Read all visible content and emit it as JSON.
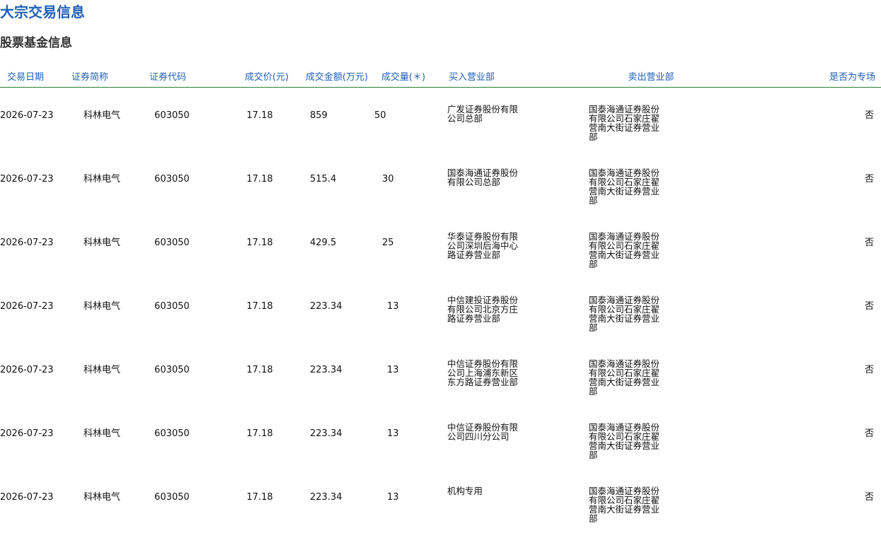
{
  "page": {
    "title": "大宗交易信息",
    "section_title": "股票基金信息"
  },
  "colors": {
    "title": "#1f5fb8",
    "header_text": "#1f5fb8",
    "header_rule": "#2e7d32",
    "body_text": "#111111"
  },
  "table": {
    "headers": {
      "date": "交易日期",
      "name": "证券简称",
      "code": "证券代码",
      "price": "成交价(元)",
      "amount": "成交金额(万元)",
      "volume": "成交量(＊)",
      "buyer": "买入营业部",
      "seller": "卖出营业部",
      "special": "是否为专场"
    },
    "rows": [
      {
        "date": "2026-07-23",
        "name": "科林电气",
        "code": "603050",
        "price": "17.18",
        "amount": "859",
        "volume": "50",
        "buyer": "广发证券股份有限公司总部",
        "seller": "国泰海通证券股份有限公司石家庄翟营南大街证券营业部",
        "special": "否"
      },
      {
        "date": "2026-07-23",
        "name": "科林电气",
        "code": "603050",
        "price": "17.18",
        "amount": "515.4",
        "volume": "30",
        "buyer": "国泰海通证券股份有限公司总部",
        "seller": "国泰海通证券股份有限公司石家庄翟营南大街证券营业部",
        "special": "否"
      },
      {
        "date": "2026-07-23",
        "name": "科林电气",
        "code": "603050",
        "price": "17.18",
        "amount": "429.5",
        "volume": "25",
        "buyer": "华泰证券股份有限公司深圳后海中心路证券营业部",
        "seller": "国泰海通证券股份有限公司石家庄翟营南大街证券营业部",
        "special": "否"
      },
      {
        "date": "2026-07-23",
        "name": "科林电气",
        "code": "603050",
        "price": "17.18",
        "amount": "223.34",
        "volume": "13",
        "buyer": "中信建投证券股份有限公司北京方庄路证券营业部",
        "seller": "国泰海通证券股份有限公司石家庄翟营南大街证券营业部",
        "special": "否"
      },
      {
        "date": "2026-07-23",
        "name": "科林电气",
        "code": "603050",
        "price": "17.18",
        "amount": "223.34",
        "volume": "13",
        "buyer": "中信证券股份有限公司上海浦东新区东方路证券营业部",
        "seller": "国泰海通证券股份有限公司石家庄翟营南大街证券营业部",
        "special": "否"
      },
      {
        "date": "2026-07-23",
        "name": "科林电气",
        "code": "603050",
        "price": "17.18",
        "amount": "223.34",
        "volume": "13",
        "buyer": "中信证券股份有限公司四川分公司",
        "seller": "国泰海通证券股份有限公司石家庄翟营南大街证券营业部",
        "special": "否"
      },
      {
        "date": "2026-07-23",
        "name": "科林电气",
        "code": "603050",
        "price": "17.18",
        "amount": "223.34",
        "volume": "13",
        "buyer": "机构专用",
        "seller": "国泰海通证券股份有限公司石家庄翟营南大街证券营业部",
        "special": "否"
      }
    ]
  }
}
